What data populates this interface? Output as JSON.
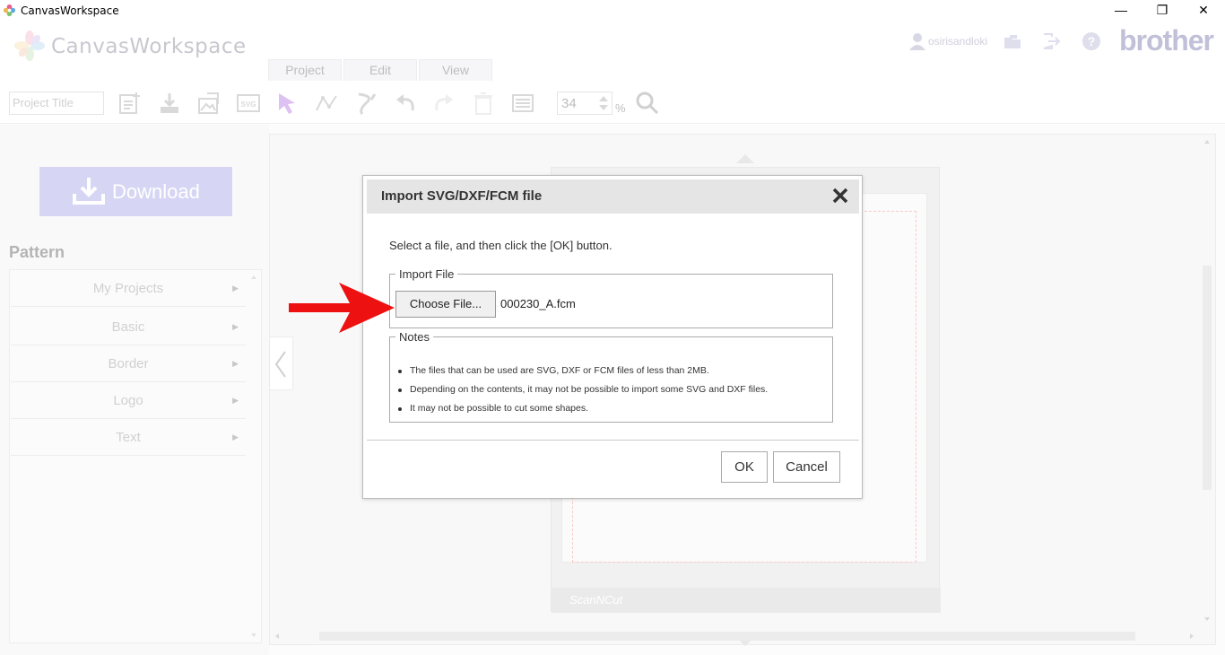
{
  "window": {
    "title": "CanvasWorkspace",
    "minimize": "—",
    "restore": "❐",
    "close": "✕"
  },
  "header": {
    "logo_text": "CanvasWorkspace",
    "tabs": [
      {
        "label": "Project"
      },
      {
        "label": "Edit"
      },
      {
        "label": "View"
      }
    ],
    "username": "osirisandloki",
    "brand": "brother"
  },
  "toolbar": {
    "project_title_placeholder": "Project Title",
    "zoom_value": "34",
    "zoom_unit": "%"
  },
  "sidebar": {
    "download_label": "Download",
    "pattern_heading": "Pattern",
    "items": [
      {
        "label": "My Projects"
      },
      {
        "label": "Basic"
      },
      {
        "label": "Border"
      },
      {
        "label": "Logo"
      },
      {
        "label": "Text"
      }
    ]
  },
  "mat": {
    "brand_text": "ScanNCut"
  },
  "dialog": {
    "title": "Import SVG/DXF/FCM file",
    "instruction": "Select a file, and then click the [OK] button.",
    "import_legend": "Import File",
    "choose_label": "Choose File...",
    "file_name": "000230_A.fcm",
    "notes_legend": "Notes",
    "notes": [
      "The files that can be used are SVG, DXF or FCM files of less than 2MB.",
      "Depending on the contents, it may not be possible to import some SVG and DXF files.",
      "It may not be possible to cut some shapes."
    ],
    "ok_label": "OK",
    "cancel_label": "Cancel"
  },
  "colors": {
    "accent": "#b4b4ec",
    "brand": "#8c8cba",
    "arrow": "#ee1111"
  }
}
